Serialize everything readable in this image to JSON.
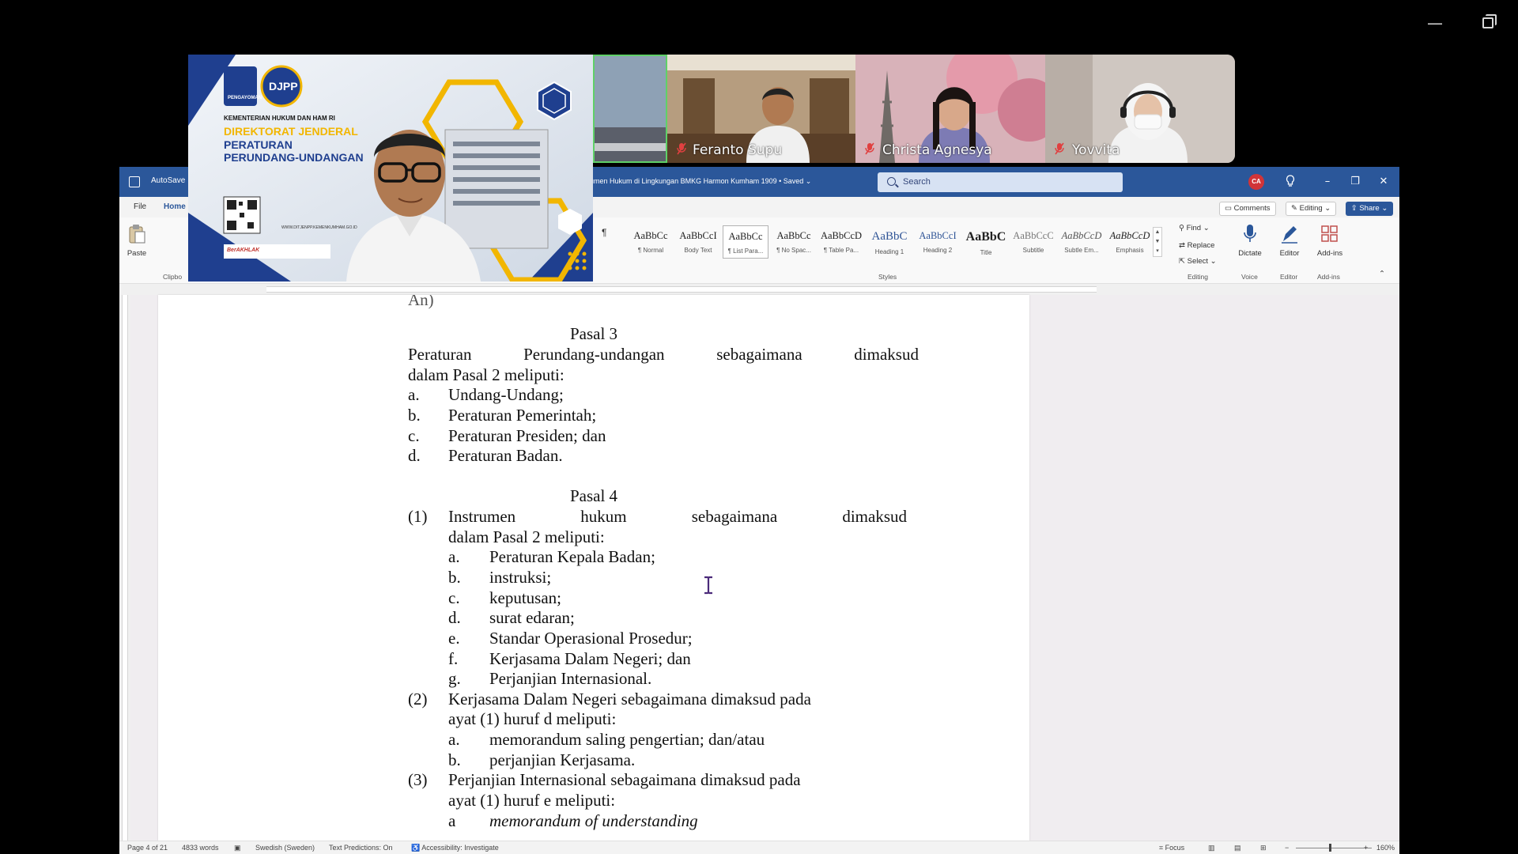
{
  "window": {
    "minimize_glyph": "—"
  },
  "participants": [
    {
      "name": "Feranto Supu",
      "muted": true
    },
    {
      "name": "Christa Agnesya",
      "muted": true
    },
    {
      "name": "Yovvita",
      "muted": true
    }
  ],
  "presenter_background": {
    "logo_text": "DJPP",
    "logo_sub": "PENGAYOMAN",
    "ministry": "KEMENTERIAN HUKUM DAN HAM RI",
    "line1": "DIREKTORAT JENDERAL",
    "line2": "PERATURAN",
    "line3": "PERUNDANG-UNDANGAN",
    "website": "WWW.DITJENPP.KEMENKUMHAM.GO.ID",
    "badge": "BerAKHLAK"
  },
  "word": {
    "autosave": "AutoSave",
    "doc_title": "umen Hukum di Lingkungan BMKG Harmon Kumham 1909 • Saved ⌄",
    "search_placeholder": "Search",
    "avatar_initials": "CA",
    "menu": {
      "file": "File",
      "home": "Home"
    },
    "comments": "Comments",
    "editing": "Editing ⌄",
    "share": "Share ⌄",
    "ribbon": {
      "paste": "Paste",
      "clipboard": "Clipbo",
      "styles_group": "Styles",
      "editing_group": "Editing",
      "voice_group": "Voice",
      "editor_group": "Editor",
      "addins_group": "Add-ins",
      "find": "Find ⌄",
      "replace": "Replace",
      "select": "Select ⌄",
      "dictate": "Dictate",
      "editor": "Editor",
      "addins": "Add-ins",
      "styles": [
        {
          "sample": "AaBbCc",
          "label": "¶ Normal",
          "selected": false
        },
        {
          "sample": "AaBbCcI",
          "label": "Body Text",
          "selected": false
        },
        {
          "sample": "AaBbCc",
          "label": "¶ List Para...",
          "selected": true
        },
        {
          "sample": "AaBbCc",
          "label": "¶ No Spac...",
          "selected": false
        },
        {
          "sample": "AaBbCcD",
          "label": "¶ Table Pa...",
          "selected": false
        },
        {
          "sample": "AaBbC",
          "label": "Heading 1",
          "selected": false
        },
        {
          "sample": "AaBbCcI",
          "label": "Heading 2",
          "selected": false
        },
        {
          "sample": "AaBbC",
          "label": "Title",
          "selected": false
        },
        {
          "sample": "AaBbCcC",
          "label": "Subtitle",
          "selected": false
        },
        {
          "sample": "AaBbCcD",
          "label": "Subtle Em...",
          "selected": false
        },
        {
          "sample": "AaBbCcD",
          "label": "Emphasis",
          "selected": false
        }
      ]
    },
    "document": {
      "top_fragment": "An)",
      "pasal3_title": "Pasal 3",
      "pasal3_intro": [
        "Peraturan",
        "Perundang-undangan",
        "sebagaimana",
        "dimaksud"
      ],
      "pasal3_intro2": "dalam Pasal 2 meliputi:",
      "pasal3_items": [
        {
          "label": "a.",
          "text": "Undang-Undang;"
        },
        {
          "label": "b.",
          "text": "Peraturan Pemerintah;"
        },
        {
          "label": "c.",
          "text": "Peraturan Presiden; dan"
        },
        {
          "label": "d.",
          "text": "Peraturan Badan."
        }
      ],
      "pasal4_title": "Pasal 4",
      "p4_1_num": "(1)",
      "p4_1_line1": [
        "Instrumen",
        "hukum",
        "sebagaimana",
        "dimaksud"
      ],
      "p4_1_line2": "dalam Pasal 2 meliputi:",
      "p4_1_items": [
        {
          "label": "a.",
          "text": "Peraturan Kepala Badan;"
        },
        {
          "label": "b.",
          "text": "instruksi;"
        },
        {
          "label": "c.",
          "text": "keputusan;"
        },
        {
          "label": "d.",
          "text": "surat edaran;"
        },
        {
          "label": "e.",
          "text": "Standar Operasional Prosedur;"
        },
        {
          "label": "f.",
          "text": "Kerjasama Dalam Negeri; dan"
        },
        {
          "label": "g.",
          "text": "Perjanjian Internasional."
        }
      ],
      "p4_2_num": "(2)",
      "p4_2_line1": "Kerjasama Dalam Negeri sebagaimana dimaksud pada",
      "p4_2_line2": "ayat (1) huruf d meliputi:",
      "p4_2_items": [
        {
          "label": "a.",
          "text": "memorandum saling pengertian; dan/atau"
        },
        {
          "label": "b.",
          "text": "perjanjian Kerjasama."
        }
      ],
      "p4_3_num": "(3)",
      "p4_3_line1": "Perjanjian Internasional sebagaimana dimaksud pada",
      "p4_3_line2": "ayat (1) huruf e meliputi:",
      "p4_3_items": [
        {
          "label": "a",
          "text": "memorandum of understanding"
        }
      ]
    },
    "status": {
      "page": "Page 4 of 21",
      "words": "4833 words",
      "language": "Swedish (Sweden)",
      "predictions": "Text Predictions: On",
      "accessibility": "Accessibility: Investigate",
      "focus": "Focus",
      "zoom": "160%"
    }
  },
  "colors": {
    "word_blue": "#2b579a",
    "muted_red": "#e04040",
    "gold": "#f2b600"
  }
}
